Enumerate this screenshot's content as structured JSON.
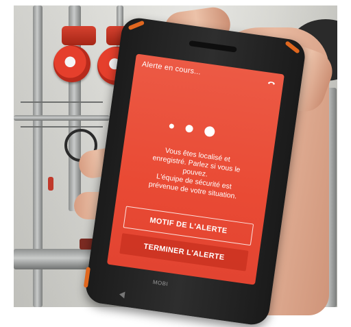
{
  "screen": {
    "title": "Alerte en cours...",
    "message": [
      "Vous êtes localisé et",
      "enregistré. Parlez si vous le",
      "pouvez.",
      "L'équipe de sécurité est",
      "prévenue de votre situation."
    ],
    "buttons": {
      "motif": "MOTIF DE L'ALERTE",
      "terminer": "TERMINER L'ALERTE"
    },
    "icons": {
      "call": "phone-hangup-icon",
      "status": "progress-dots"
    },
    "colors": {
      "screen_bg": "#e94a34",
      "bumper": "#e0671f"
    }
  },
  "device": {
    "brand": "MOBI"
  }
}
